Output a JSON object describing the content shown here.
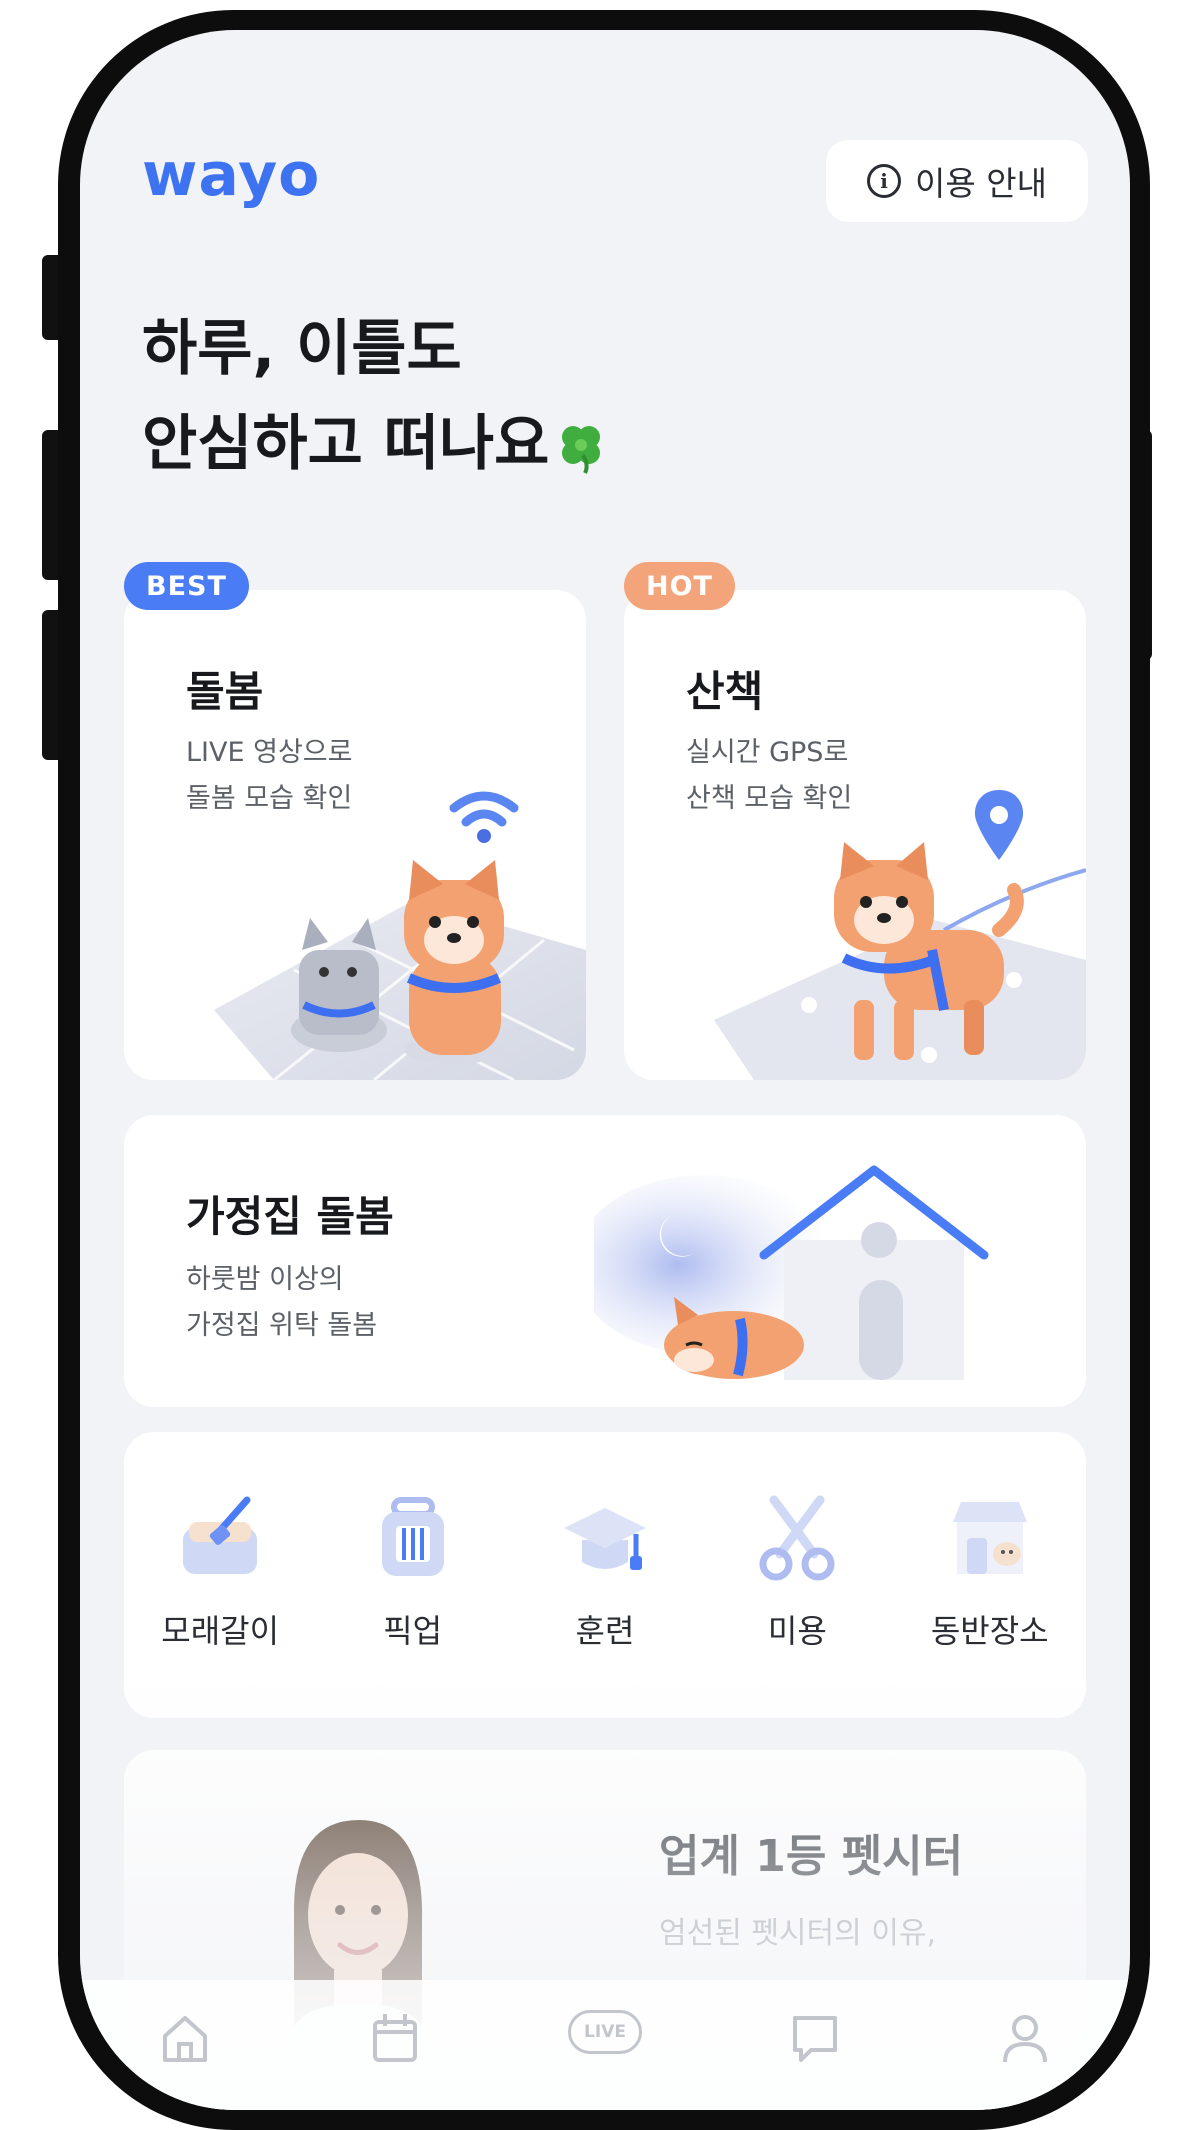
{
  "app": {
    "logo": "wayo"
  },
  "header": {
    "info_label": "이용 안내",
    "info_icon": "info-icon"
  },
  "hero": {
    "line1": "하루, 이틀도",
    "line2": "안심하고 떠나요"
  },
  "cards": {
    "care": {
      "badge": "BEST",
      "title": "돌봄",
      "sub1": "LIVE 영상으로",
      "sub2": "돌봄 모습 확인"
    },
    "walk": {
      "badge": "HOT",
      "title": "산책",
      "sub1": "실시간 GPS로",
      "sub2": "산책 모습 확인"
    },
    "home": {
      "title": "가정집 돌봄",
      "sub1": "하룻밤 이상의",
      "sub2": "가정집 위탁 돌봄"
    }
  },
  "services": [
    {
      "label": "모래갈이",
      "icon": "litter-box-icon"
    },
    {
      "label": "픽업",
      "icon": "pet-carrier-icon"
    },
    {
      "label": "훈련",
      "icon": "graduation-cap-icon"
    },
    {
      "label": "미용",
      "icon": "scissors-icon"
    },
    {
      "label": "동반장소",
      "icon": "store-icon"
    }
  ],
  "promo": {
    "title": "업계 1등 펫시터",
    "sub": "엄선된 펫시터의 이유,"
  },
  "nav": [
    {
      "icon": "home-icon"
    },
    {
      "icon": "calendar-icon"
    },
    {
      "icon": "live-icon",
      "label": "LIVE"
    },
    {
      "icon": "chat-icon"
    },
    {
      "icon": "profile-icon"
    }
  ],
  "colors": {
    "brand": "#3d72f0",
    "best": "#4a7cf6",
    "hot": "#f4a47a",
    "background": "#f2f3f6"
  }
}
